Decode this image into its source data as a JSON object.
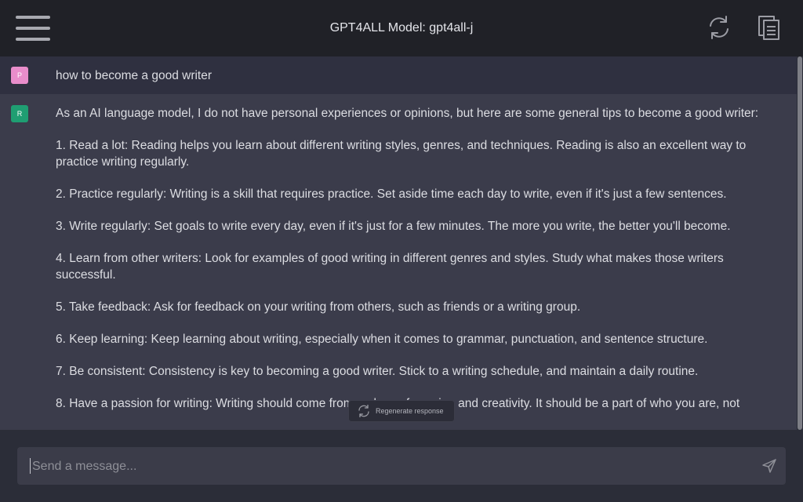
{
  "header": {
    "title": "GPT4ALL Model: gpt4all-j",
    "icons": {
      "menu": "hamburger-menu-icon",
      "refresh": "refresh-icon",
      "copy": "copy-icon"
    }
  },
  "conversation": {
    "prompt": {
      "avatar": "P",
      "text": "how to become a good writer"
    },
    "response": {
      "avatar": "R",
      "paragraphs": [
        "As an AI language model, I do not have personal experiences or opinions, but here are some general tips to become a good writer:",
        "1. Read a lot: Reading helps you learn about different writing styles, genres, and techniques. Reading is also an excellent way to practice writing regularly.",
        "2. Practice regularly: Writing is a skill that requires practice. Set aside time each day to write, even if it's just a few sentences.",
        "3. Write regularly: Set goals to write every day, even if it's just for a few minutes. The more you write, the better you'll become.",
        "4. Learn from other writers: Look for examples of good writing in different genres and styles. Study what makes those writers successful.",
        "5. Take feedback: Ask for feedback on your writing from others, such as friends or a writing group.",
        "6. Keep learning: Keep learning about writing, especially when it comes to grammar, punctuation, and sentence structure.",
        "7. Be consistent: Consistency is key to becoming a good writer. Stick to a writing schedule, and maintain a daily routine.",
        "8. Have a passion for writing: Writing should come from a place of passion and creativity. It should be a part of who you are, not"
      ]
    }
  },
  "regenerate": {
    "label": "Regenerate response",
    "icon": "regenerate-icon"
  },
  "input": {
    "placeholder": "Send a message...",
    "value": "",
    "send_icon": "send-icon"
  },
  "colors": {
    "header_bg": "#202127",
    "prompt_bg": "#2f3040",
    "response_bg": "#3b3c4b",
    "prompt_avatar": "#e98dcb",
    "response_avatar": "#1f9e72",
    "input_bg": "#3b3c49"
  }
}
